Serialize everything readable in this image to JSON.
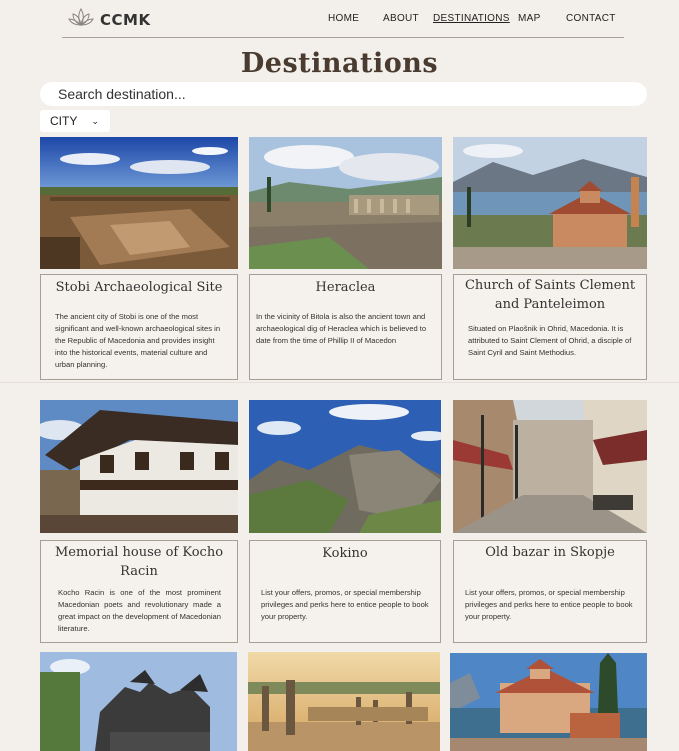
{
  "brand": {
    "name": "CCMK",
    "icon": "lotus-icon"
  },
  "nav": {
    "items": [
      {
        "label": "HOME",
        "active": false
      },
      {
        "label": "ABOUT",
        "active": false
      },
      {
        "label": "DESTINATIONS",
        "active": true
      },
      {
        "label": "MAP",
        "active": false
      },
      {
        "label": "CONTACT",
        "active": false
      }
    ]
  },
  "page": {
    "title": "Destinations"
  },
  "search": {
    "placeholder": "Search destination..."
  },
  "filter": {
    "selected": "CITY",
    "icon": "chevron-down-icon"
  },
  "cards": [
    {
      "name": "Stobi Archaeological Site",
      "description": "The ancient city of Stobi is one of the most significant and well-known archaeological sites in the Republic of Macedonia and provides insight into the historical events, material culture and urban planning."
    },
    {
      "name": "Heraclea",
      "description": "In the vicinity of Bitola is also the ancient town and archaeological dig of Heraclea which is believed to date from the time of Phillip II of Macedon"
    },
    {
      "name": "Church of Saints Clement and Panteleimon",
      "description": "Situated on Plaošnik in Ohrid, Macedonia. It is attributed to Saint Clement of Ohrid, a disciple of Saint Cyril and Saint Methodius."
    },
    {
      "name": "Memorial house of Kocho Racin",
      "description": "Kocho Racin is one of the most prominent Macedonian poets and revolutionary made a great impact on the development of Macedonian literature."
    },
    {
      "name": "Kokino",
      "description": "List your offers, promos, or special membership privileges and perks here to entice people to book your property."
    },
    {
      "name": "Old bazar in Skopje",
      "description": "List your offers, promos, or special membership privileges and perks here to entice people to book your property."
    }
  ],
  "colors": {
    "background": "#f3efea",
    "title": "#4a3b30",
    "card_border": "#a99e92"
  }
}
